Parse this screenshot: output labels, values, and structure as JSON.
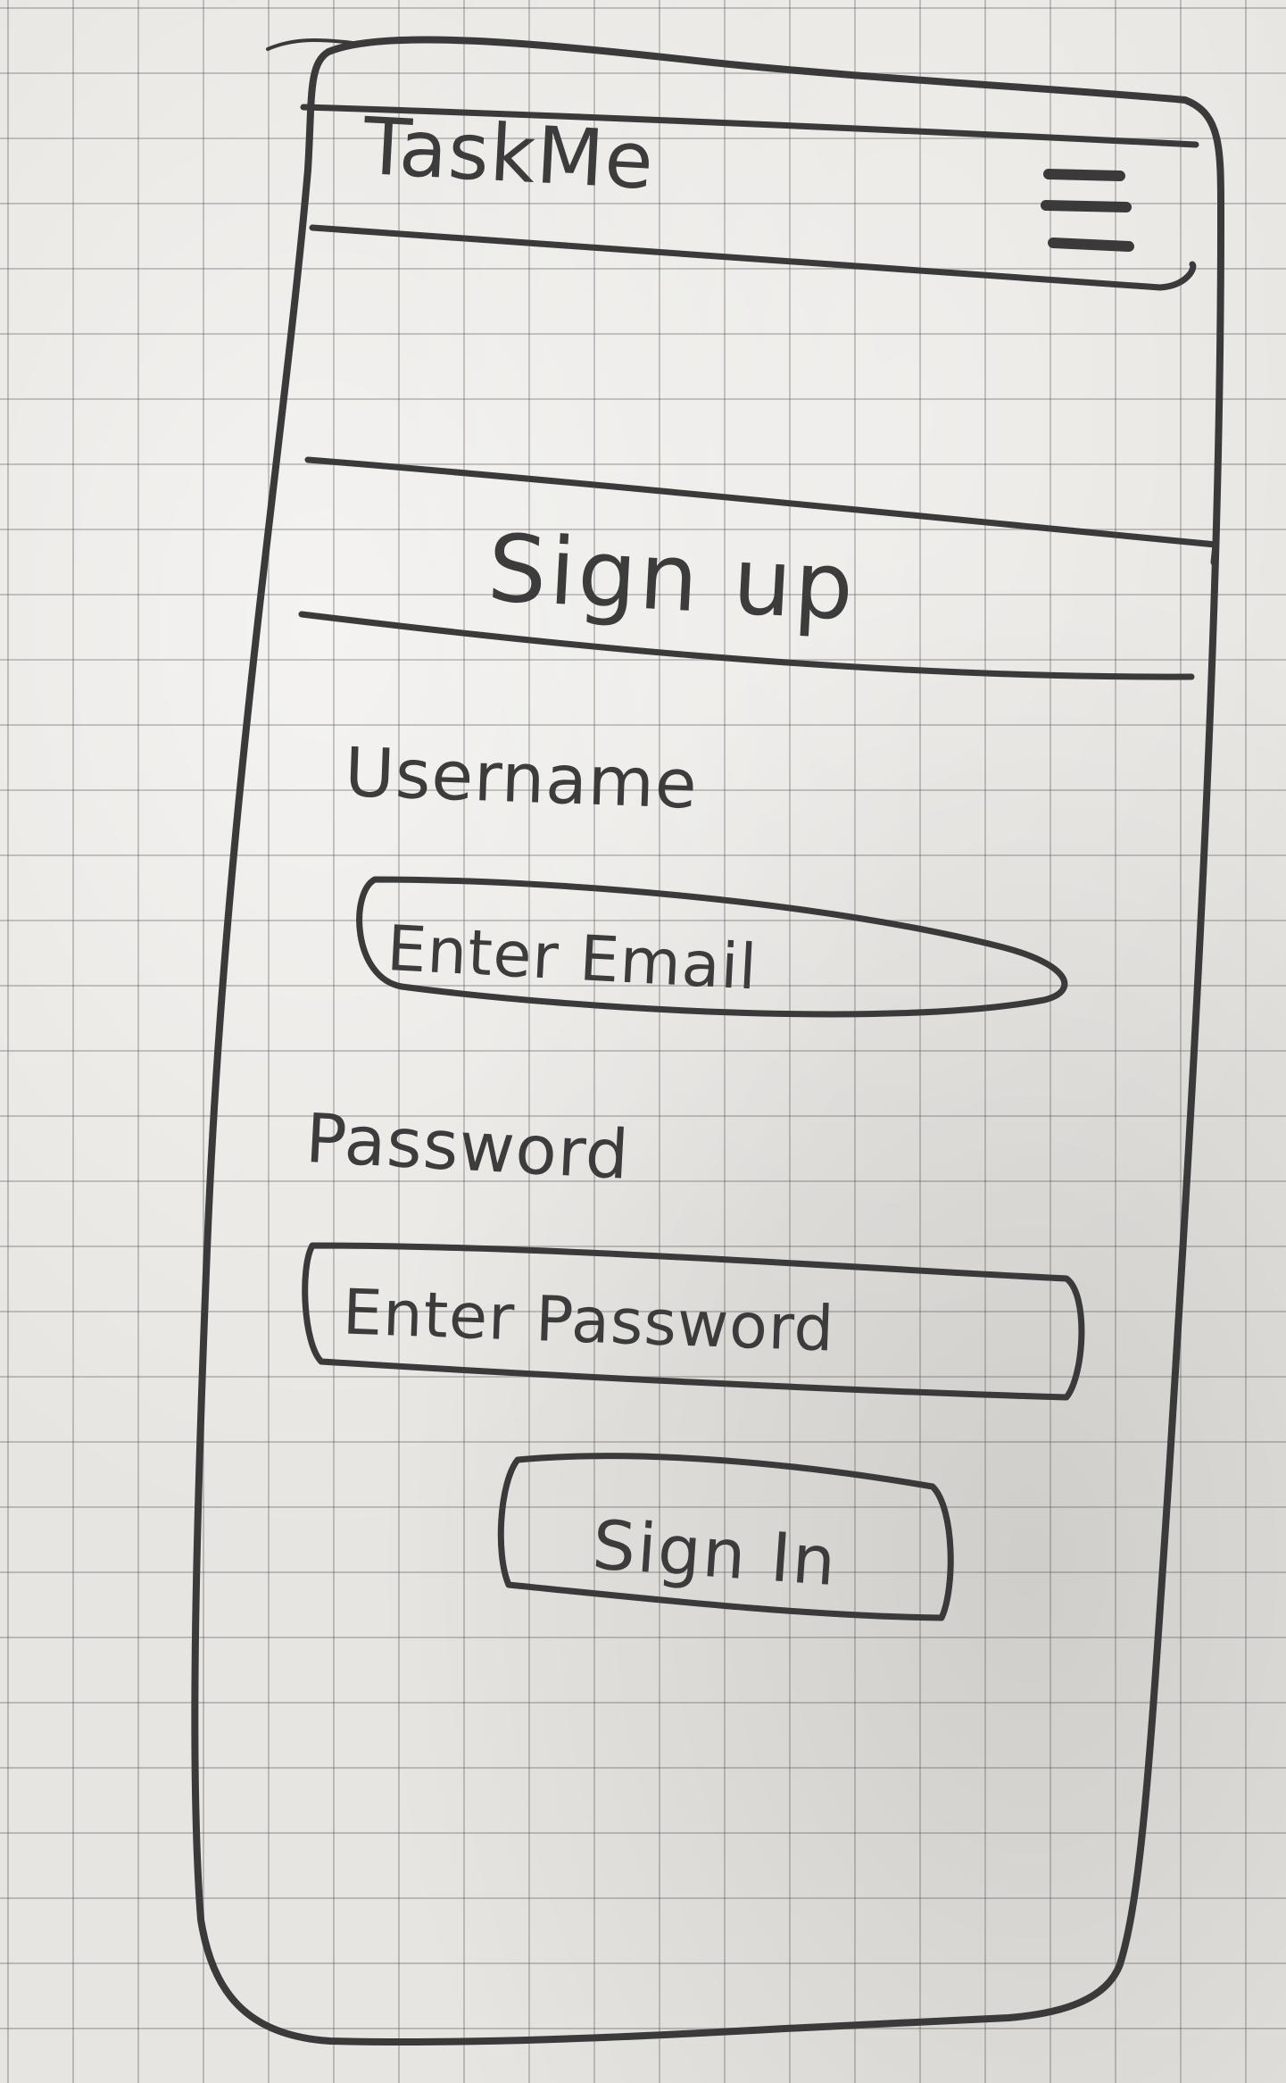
{
  "app": {
    "title": "TaskMe"
  },
  "header": {
    "menu_icon": "hamburger-menu-icon"
  },
  "hero": {
    "title": "Sign up"
  },
  "form": {
    "username_label": "Username",
    "username_placeholder": "Enter Email",
    "password_label": "Password",
    "password_placeholder": "Enter Password",
    "submit_label": "Sign In"
  },
  "colors": {
    "paper": "#e7e5e1",
    "pencil": "#3a3a3a",
    "grid": "#9a9a9a"
  }
}
